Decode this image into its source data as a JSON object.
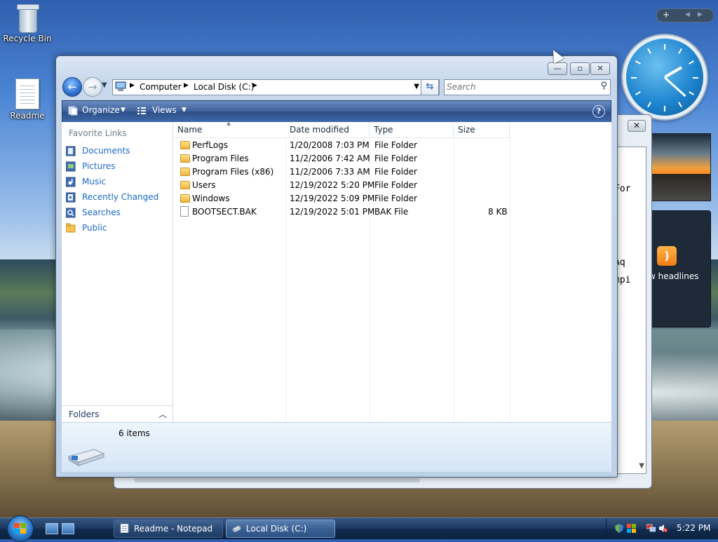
{
  "desktop": {
    "icons": [
      {
        "label": "Recycle Bin",
        "icon": "recycle-bin-icon"
      },
      {
        "label": "Readme",
        "icon": "text-document-icon"
      }
    ]
  },
  "gadgets": {
    "clock_time": "5:22",
    "feed_label": "w headlines",
    "toolbar_add": "+",
    "toolbar_prev": "◀",
    "toolbar_next": "▶"
  },
  "notepad_bg": {
    "visible_fragments": [
      "For",
      "Aq",
      "mpi"
    ]
  },
  "explorer": {
    "window_buttons": {
      "minimize": "—",
      "maximize": "▫",
      "close": "✕"
    },
    "address": {
      "crumbs": [
        "Computer",
        "Local Disk (C:)"
      ]
    },
    "search": {
      "placeholder": "Search"
    },
    "toolbar": {
      "organize": "Organize",
      "views": "Views",
      "help": "?"
    },
    "favorite_links": {
      "title": "Favorite Links",
      "items": [
        {
          "label": "Documents",
          "icon": "documents-icon"
        },
        {
          "label": "Pictures",
          "icon": "pictures-icon"
        },
        {
          "label": "Music",
          "icon": "music-icon"
        },
        {
          "label": "Recently Changed",
          "icon": "recently-changed-icon"
        },
        {
          "label": "Searches",
          "icon": "searches-icon"
        },
        {
          "label": "Public",
          "icon": "public-folder-icon"
        }
      ]
    },
    "folders_label": "Folders",
    "columns": {
      "name": "Name",
      "date": "Date modified",
      "type": "Type",
      "size": "Size"
    },
    "files": [
      {
        "name": "PerfLogs",
        "date": "1/20/2008 7:03 PM",
        "type": "File Folder",
        "size": "",
        "kind": "folder"
      },
      {
        "name": "Program Files",
        "date": "11/2/2006 7:42 AM",
        "type": "File Folder",
        "size": "",
        "kind": "folder"
      },
      {
        "name": "Program Files (x86)",
        "date": "11/2/2006 7:33 AM",
        "type": "File Folder",
        "size": "",
        "kind": "folder"
      },
      {
        "name": "Users",
        "date": "12/19/2022 5:20 PM",
        "type": "File Folder",
        "size": "",
        "kind": "folder"
      },
      {
        "name": "Windows",
        "date": "12/19/2022 5:09 PM",
        "type": "File Folder",
        "size": "",
        "kind": "folder"
      },
      {
        "name": "BOOTSECT.BAK",
        "date": "12/19/2022 5:01 PM",
        "type": "BAK File",
        "size": "8 KB",
        "kind": "file"
      }
    ],
    "details": {
      "count": "6 items"
    }
  },
  "taskbar": {
    "tasks": [
      {
        "label": "Readme - Notepad",
        "icon": "notepad-icon",
        "active": false
      },
      {
        "label": "Local Disk (C:)",
        "icon": "drive-icon",
        "active": true
      }
    ],
    "time": "5:22 PM"
  }
}
